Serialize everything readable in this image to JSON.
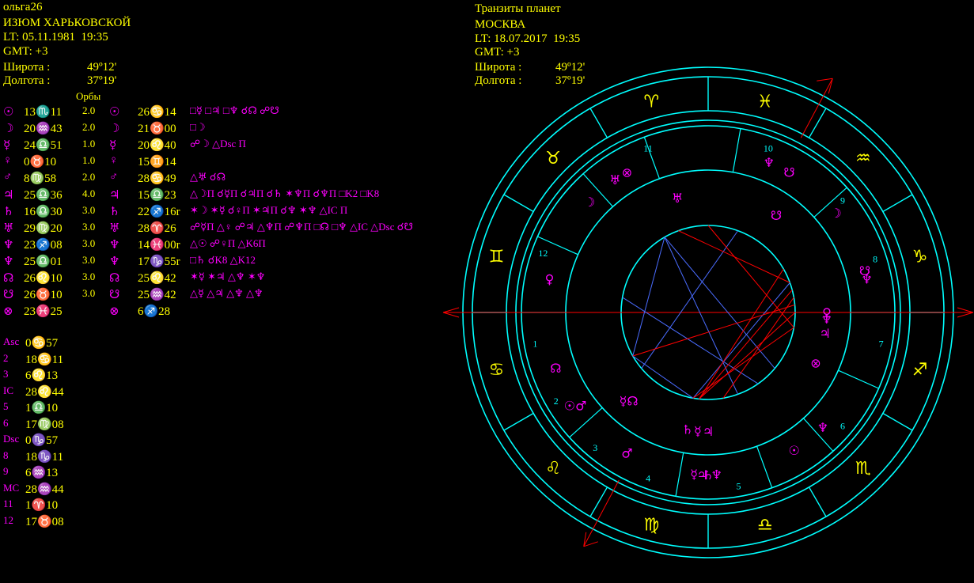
{
  "natal": {
    "name": "ольга26",
    "place": "ИЗЮМ ХАРЬКОВСКОЙ",
    "lt": "LT: 05.11.1981  19:35",
    "gmt": "GMT: +3",
    "lat_label": "Широта :",
    "lat_value": "49º12'",
    "lon_label": "Долгота :",
    "lon_value": "37º19'"
  },
  "transit": {
    "title": "Транзиты планет",
    "place": "МОСКВА",
    "lt": "LT: 18.07.2017  19:35",
    "gmt": "GMT: +3",
    "lat_label": "Широта :",
    "lat_value": "49º12'",
    "lon_label": "Долгота :",
    "lon_value": "37º19'"
  },
  "orbs_label": "Орбы",
  "planets": [
    {
      "sym": "☉",
      "natal": "13♏11",
      "orb": "2.0",
      "tsym": "☉",
      "transit": "26♋14",
      "aspects": "□☿ □♃ □♆ ☌☊ ☍☋"
    },
    {
      "sym": "☽",
      "natal": "20♒43",
      "orb": "2.0",
      "tsym": "☽",
      "transit": "21♉00",
      "aspects": "□☽"
    },
    {
      "sym": "☿",
      "natal": "24♎51",
      "orb": "1.0",
      "tsym": "☿",
      "transit": "20♌40",
      "aspects": "☍☽ △Dsc П"
    },
    {
      "sym": "♀",
      "natal": "0♉10",
      "orb": "1.0",
      "tsym": "♀",
      "transit": "15♊14",
      "aspects": ""
    },
    {
      "sym": "♂",
      "natal": "8♍58",
      "orb": "2.0",
      "tsym": "♂",
      "transit": "28♋49",
      "aspects": "△♅ ☌☊"
    },
    {
      "sym": "♃",
      "natal": "25♎36",
      "orb": "4.0",
      "tsym": "♃",
      "transit": "15♎23",
      "aspects": "△☽П ☌☿П ☌♃П ☌♄ ✶♆П ☌♆П □K2 □K8"
    },
    {
      "sym": "♄",
      "natal": "16♎30",
      "orb": "3.0",
      "tsym": "♄",
      "transit": "22♐16r",
      "aspects": "✶☽ ✶☿ ☌♀П ✶♃П ☌♆ ✶♆ △IC П"
    },
    {
      "sym": "♅",
      "natal": "29♍20",
      "orb": "3.0",
      "tsym": "♅",
      "transit": "28♈26",
      "aspects": "☍☿П △♀ ☍♃ △♆П ☍♆П □☊ □♆ △IC △Dsc ☌☋"
    },
    {
      "sym": "♆",
      "natal": "23♐08",
      "orb": "3.0",
      "tsym": "♆",
      "transit": "14♓00r",
      "aspects": "△☉ ☍♀П △K6П"
    },
    {
      "sym": "♆",
      "natal": "25♎01",
      "orb": "3.0",
      "tsym": "♆",
      "transit": "17♑55r",
      "aspects": "□♄ ☌K8 △K12"
    },
    {
      "sym": "☊",
      "natal": "26♌10",
      "orb": "3.0",
      "tsym": "☊",
      "transit": "25♌42",
      "aspects": "✶☿ ✶♃ △♆ ✶♆"
    },
    {
      "sym": "☋",
      "natal": "26♉10",
      "orb": "3.0",
      "tsym": "☋",
      "transit": "25♒42",
      "aspects": "△☿ △♃ △♆ △♆"
    },
    {
      "sym": "⊗",
      "natal": "23♓25",
      "orb": "",
      "tsym": "⊗",
      "transit": "6♐28",
      "aspects": ""
    }
  ],
  "houses": [
    {
      "label": "Asc",
      "value": "0♋57"
    },
    {
      "label": "2",
      "value": "18♋11"
    },
    {
      "label": "3",
      "value": "6♌13"
    },
    {
      "label": "IC",
      "value": "28♌44"
    },
    {
      "label": "5",
      "value": "1♎10"
    },
    {
      "label": "6",
      "value": "17♍08"
    },
    {
      "label": "Dsc",
      "value": "0♑57"
    },
    {
      "label": "8",
      "value": "18♑11"
    },
    {
      "label": "9",
      "value": "6♒13"
    },
    {
      "label": "MC",
      "value": "28♒44"
    },
    {
      "label": "11",
      "value": "1♈10"
    },
    {
      "label": "12",
      "value": "17♉08"
    }
  ],
  "wheel": {
    "signs": [
      {
        "glyph": "♈",
        "lon": 105
      },
      {
        "glyph": "♓",
        "lon": 75
      },
      {
        "glyph": "♒",
        "lon": 45
      },
      {
        "glyph": "♑",
        "lon": 15
      },
      {
        "glyph": "♐",
        "lon": -15
      },
      {
        "glyph": "♏",
        "lon": -45
      },
      {
        "glyph": "♎",
        "lon": -75
      },
      {
        "glyph": "♍",
        "lon": -105
      },
      {
        "glyph": "♌",
        "lon": -135
      },
      {
        "glyph": "♋",
        "lon": -165
      },
      {
        "glyph": "♊",
        "lon": 165
      },
      {
        "glyph": "♉",
        "lon": 135
      }
    ],
    "house_numbers": [
      {
        "n": "1",
        "lon": -170
      },
      {
        "n": "2",
        "lon": -150
      },
      {
        "n": "3",
        "lon": -130
      },
      {
        "n": "4",
        "lon": -110
      },
      {
        "n": "5",
        "lon": -80
      },
      {
        "n": "6",
        "lon": -40
      },
      {
        "n": "7",
        "lon": -10
      },
      {
        "n": "8",
        "lon": 18
      },
      {
        "n": "9",
        "lon": 40
      },
      {
        "n": "10",
        "lon": 70
      },
      {
        "n": "11",
        "lon": 110
      },
      {
        "n": "12",
        "lon": 160
      }
    ],
    "natal_glyphs": [
      {
        "g": "♅",
        "lon": 125
      },
      {
        "g": "⊗",
        "lon": 120
      },
      {
        "g": "☽",
        "lon": 137
      },
      {
        "g": "♀",
        "lon": 168
      },
      {
        "g": "☊",
        "lon": -160
      },
      {
        "g": "☉♂",
        "lon": -145
      },
      {
        "g": "☿",
        "lon": -95
      },
      {
        "g": "♃",
        "lon": -92
      },
      {
        "g": "♄",
        "lon": -90
      },
      {
        "g": "♆",
        "lon": -87
      },
      {
        "g": "♂",
        "lon": -120
      },
      {
        "g": "☉",
        "lon": -58
      },
      {
        "g": "♆",
        "lon": -45
      },
      {
        "g": "♆",
        "lon": 68
      },
      {
        "g": "☋",
        "lon": 60
      },
      {
        "g": "☽",
        "lon": 38
      },
      {
        "g": "☋",
        "lon": 15
      },
      {
        "g": "♆",
        "lon": 12
      }
    ],
    "transit_glyphs": [
      {
        "g": "☿☊",
        "lon": -132
      },
      {
        "g": "♄",
        "lon": -100
      },
      {
        "g": "☿",
        "lon": -95
      },
      {
        "g": "♃",
        "lon": -90
      },
      {
        "g": "⊗",
        "lon": -25
      },
      {
        "g": "♃",
        "lon": -10
      },
      {
        "g": "♀",
        "lon": 0
      },
      {
        "g": "♆",
        "lon": -3
      },
      {
        "g": "♅",
        "lon": 105
      },
      {
        "g": "☋",
        "lon": 55
      }
    ]
  },
  "colors": {
    "yellow": "#ffff00",
    "magenta": "#ff00ff",
    "cyan": "#00ffff",
    "red": "#ff0000",
    "blue": "#4a6cff",
    "white": "#ffffff"
  }
}
